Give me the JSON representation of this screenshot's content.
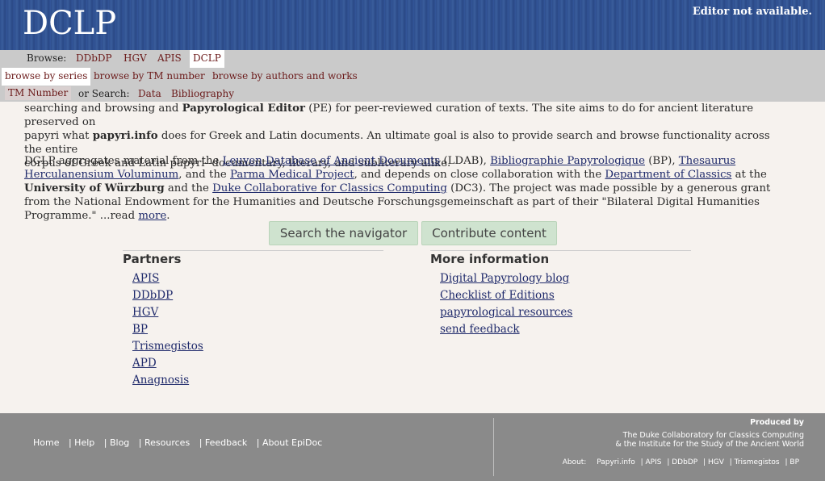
{
  "header": {
    "logo": "DCLP",
    "editor_status": "Editor not available."
  },
  "nav": {
    "browse_label": "Browse:",
    "browse_items": [
      "DDbDP",
      "HGV",
      "APIS",
      "DCLP"
    ],
    "browse_active": "DCLP",
    "browse_sub": [
      "browse by series",
      "browse by TM number",
      "browse by authors and works"
    ],
    "browse_sub_active": "browse by series",
    "tm_number": "TM Number",
    "search_label": "or Search:",
    "search_items": [
      "Data",
      "Bibliography"
    ]
  },
  "intro": {
    "p1_line1_a": "searching and browsing and ",
    "p1_line1_b": "Papyrological Editor",
    "p1_line1_c": " (PE) for peer-reviewed curation of texts. The site aims to do for ancient literature preserved on",
    "p1_line2_a": "papyri what ",
    "p1_line2_b": "papyri.info",
    "p1_line2_c": " does for Greek and Latin documents. An ultimate goal is also to provide search and browse functionality across the entire",
    "p1_line3": "corpus of Greek and Latin papyri--documentary, literary, and subliterary alike.",
    "p2_a": "DCLP aggregates material from the ",
    "p2_link_ldab": "Leuven Database of Ancient Documents",
    "p2_b": " (LDAB), ",
    "p2_link_bp": "Bibliographie Papyrologique",
    "p2_c": " (BP), ",
    "p2_link_thv": "Thesaurus Herculanensium Voluminum",
    "p2_d": ", and the ",
    "p2_link_pmp": "Parma Medical Project",
    "p2_e": ", and depends on close collaboration with the ",
    "p2_link_doc": "Department of Classics",
    "p2_f": " at the ",
    "p2_uw": "University of Würzburg",
    "p2_g": " and the ",
    "p2_link_dc3": "Duke Collaborative for Classics Computing",
    "p2_h": " (DC3). The project was made possible by a generous grant from the National Endowment for the Humanities and Deutsche Forschungsgemeinschaft as part of their \"Bilateral Digital Humanities Programme.\" ...read ",
    "p2_more": "more",
    "p2_end": "."
  },
  "buttons": {
    "search": "Search the navigator",
    "contribute": "Contribute content"
  },
  "partners": {
    "title": "Partners",
    "links": [
      "APIS",
      "DDbDP",
      "HGV",
      "BP",
      "Trismegistos",
      "APD",
      "Anagnosis"
    ]
  },
  "more_info": {
    "title": "More information",
    "links": [
      "Digital Papyrology blog",
      "Checklist of Editions",
      "papyrological resources",
      "send feedback"
    ]
  },
  "footer": {
    "links": [
      "Home",
      "| Help",
      "| Blog",
      "| Resources",
      "| Feedback",
      "| About EpiDoc"
    ],
    "produced_by": "Produced by",
    "duke_line1": "The Duke Collaboratory for Classics Computing",
    "duke_line2": "& the Institute for the Study of the Ancient World",
    "about_label": "About:",
    "about_links": [
      "Papyri.info",
      "| APIS",
      "| DDbDP",
      "| HGV",
      "| Trismegistos",
      "| BP"
    ]
  }
}
